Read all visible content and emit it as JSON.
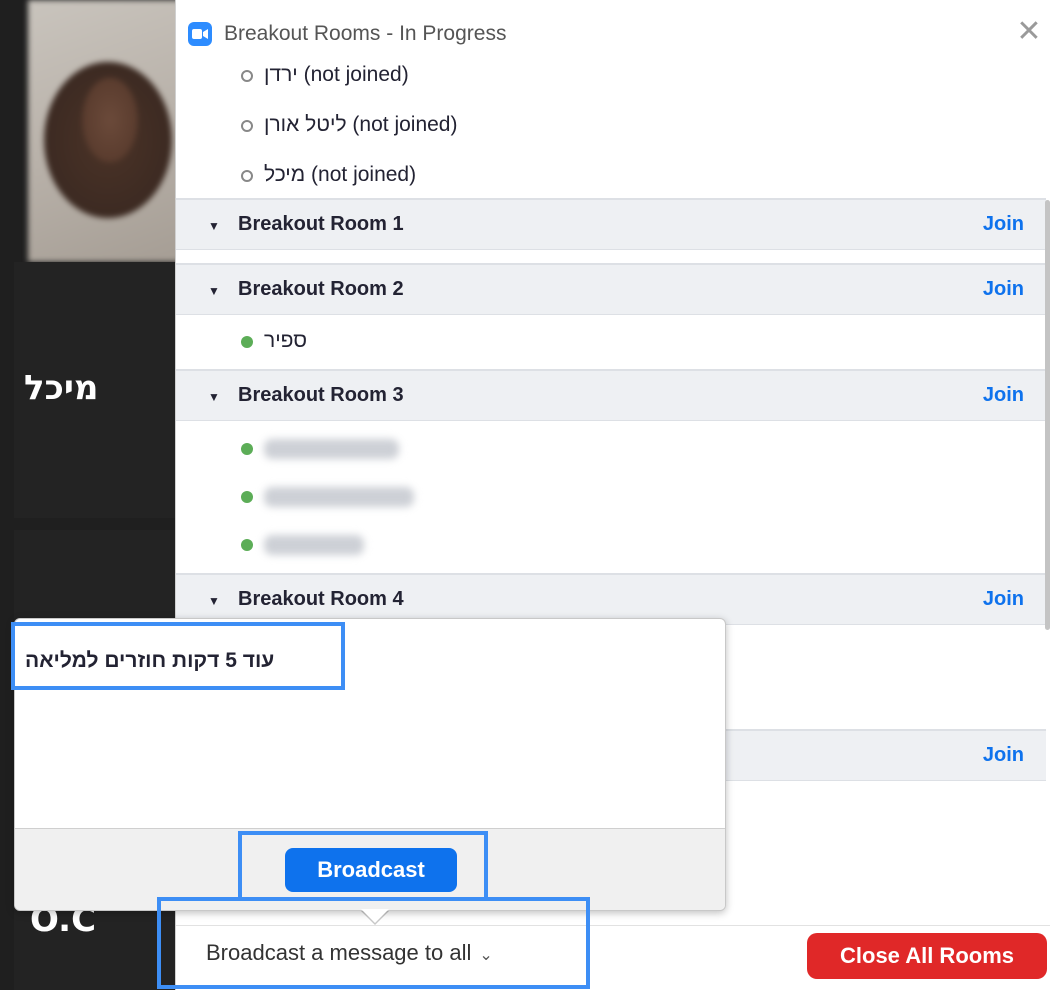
{
  "window": {
    "title": "Breakout Rooms - In Progress",
    "close_glyph": "✕"
  },
  "video_tiles": [
    {
      "name": ""
    },
    {
      "name": "מיכל"
    },
    {
      "name": "O.C"
    }
  ],
  "unassigned_members": [
    {
      "name": "ירדן",
      "status": "(not joined)"
    },
    {
      "name": "ליטל אורן",
      "status": "(not joined)"
    },
    {
      "name": "מיכל",
      "status": "(not joined)"
    }
  ],
  "rooms": [
    {
      "name": "Breakout Room 1",
      "join_label": "Join",
      "members": []
    },
    {
      "name": "Breakout Room 2",
      "join_label": "Join",
      "members": [
        {
          "name": "ספיר",
          "blurred": false
        }
      ]
    },
    {
      "name": "Breakout Room 3",
      "join_label": "Join",
      "members": [
        {
          "name": "",
          "blurred": true
        },
        {
          "name": "",
          "blurred": true
        },
        {
          "name": "",
          "blurred": true
        }
      ]
    },
    {
      "name": "Breakout Room 4",
      "join_label": "Join",
      "members": []
    },
    {
      "name": "",
      "join_label": "Join",
      "members": []
    }
  ],
  "broadcast_popup": {
    "message": "עוד 5 דקות חוזרים למליאה",
    "button_label": "Broadcast"
  },
  "footer": {
    "broadcast_dropdown_label": "Broadcast a message to all",
    "close_all_label": "Close All Rooms"
  },
  "colors": {
    "accent": "#0e72ed",
    "danger": "#e02828",
    "online": "#5cad57",
    "highlight": "#3d8ef5"
  }
}
